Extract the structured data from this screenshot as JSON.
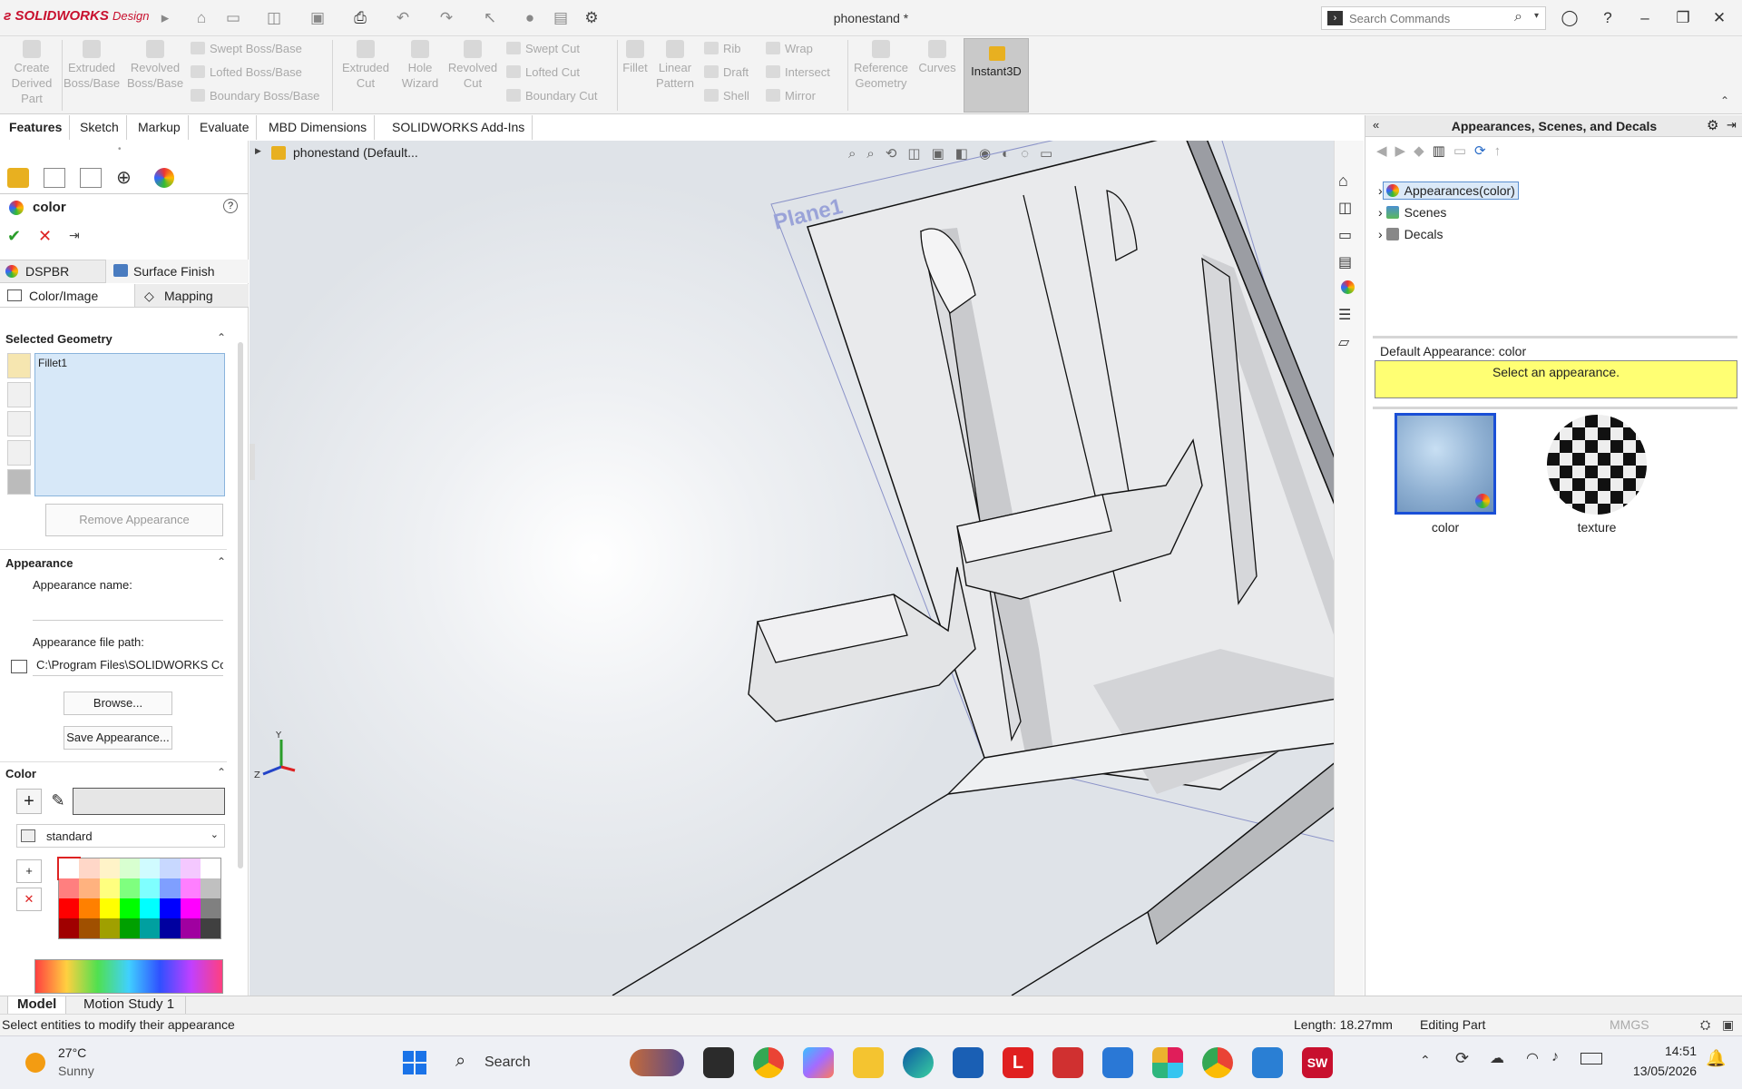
{
  "titlebar": {
    "app_name": "SOLIDWORKS",
    "app_suffix": "Design",
    "document_title": "phonestand *",
    "search_placeholder": "Search Commands"
  },
  "ribbon": {
    "buttons": [
      {
        "label": "Create Derived Part"
      },
      {
        "label": "Extruded Boss/Base"
      },
      {
        "label": "Revolved Boss/Base"
      },
      {
        "label": "Swept Boss/Base"
      },
      {
        "label": "Lofted Boss/Base"
      },
      {
        "label": "Boundary Boss/Base"
      },
      {
        "label": "Extruded Cut"
      },
      {
        "label": "Hole Wizard"
      },
      {
        "label": "Revolved Cut"
      },
      {
        "label": "Swept Cut"
      },
      {
        "label": "Lofted Cut"
      },
      {
        "label": "Boundary Cut"
      },
      {
        "label": "Fillet"
      },
      {
        "label": "Linear Pattern"
      },
      {
        "label": "Rib"
      },
      {
        "label": "Draft"
      },
      {
        "label": "Shell"
      },
      {
        "label": "Wrap"
      },
      {
        "label": "Intersect"
      },
      {
        "label": "Mirror"
      },
      {
        "label": "Reference Geometry"
      },
      {
        "label": "Curves"
      },
      {
        "label": "Instant3D"
      }
    ]
  },
  "command_tabs": [
    "Features",
    "Sketch",
    "Markup",
    "Evaluate",
    "MBD Dimensions",
    "SOLIDWORKS Add-Ins"
  ],
  "left_panel": {
    "title": "color",
    "tabs_row1": [
      "DSPBR",
      "Surface Finish"
    ],
    "tabs_row2": [
      "Color/Image",
      "Mapping"
    ],
    "selected_geometry": {
      "heading": "Selected Geometry",
      "items": [
        "Fillet1"
      ],
      "remove_button": "Remove Appearance"
    },
    "appearance": {
      "heading": "Appearance",
      "name_label": "Appearance name:",
      "name_value": "",
      "path_label": "Appearance file path:",
      "path_value": "C:\\Program Files\\SOLIDWORKS Co",
      "browse_button": "Browse...",
      "save_button": "Save Appearance..."
    },
    "color": {
      "heading": "Color",
      "swatch_hex": "#e6e6e6",
      "palette": "standard",
      "palette_colors": [
        [
          "#ffffff",
          "#ffd7c8",
          "#fff3c8",
          "#d8ffd0",
          "#d0fbff",
          "#c8d8ff",
          "#f4c8ff",
          "#ffffff"
        ],
        [
          "#ff7f7f",
          "#ffb27f",
          "#ffff7f",
          "#7fff7f",
          "#7fffff",
          "#7f9fff",
          "#ff7fff",
          "#c0c0c0"
        ],
        [
          "#ff0000",
          "#ff8000",
          "#ffff00",
          "#00ff00",
          "#00ffff",
          "#0000ff",
          "#ff00ff",
          "#808080"
        ],
        [
          "#a00000",
          "#a05000",
          "#a0a000",
          "#00a000",
          "#00a0a0",
          "#0000a0",
          "#a000a0",
          "#404040"
        ]
      ]
    }
  },
  "viewport": {
    "tree_root": "phonestand (Default...",
    "plane_label": "Plane1"
  },
  "right_panel": {
    "title": "Appearances, Scenes, and Decals",
    "tree": [
      "Appearances(color)",
      "Scenes",
      "Decals"
    ],
    "default_label": "Default Appearance: color",
    "hint": "Select an appearance.",
    "swatches": [
      "color",
      "texture"
    ]
  },
  "model_tabs": [
    "Model",
    "Motion Study 1"
  ],
  "status": {
    "message": "Select entities to modify their appearance",
    "length": "Length: 18.27mm",
    "mode": "Editing Part",
    "units": "MMGS"
  },
  "taskbar": {
    "weather_temp": "27°C",
    "weather_desc": "Sunny",
    "search": "Search",
    "time": "14:51",
    "date": "13/05/2026"
  }
}
